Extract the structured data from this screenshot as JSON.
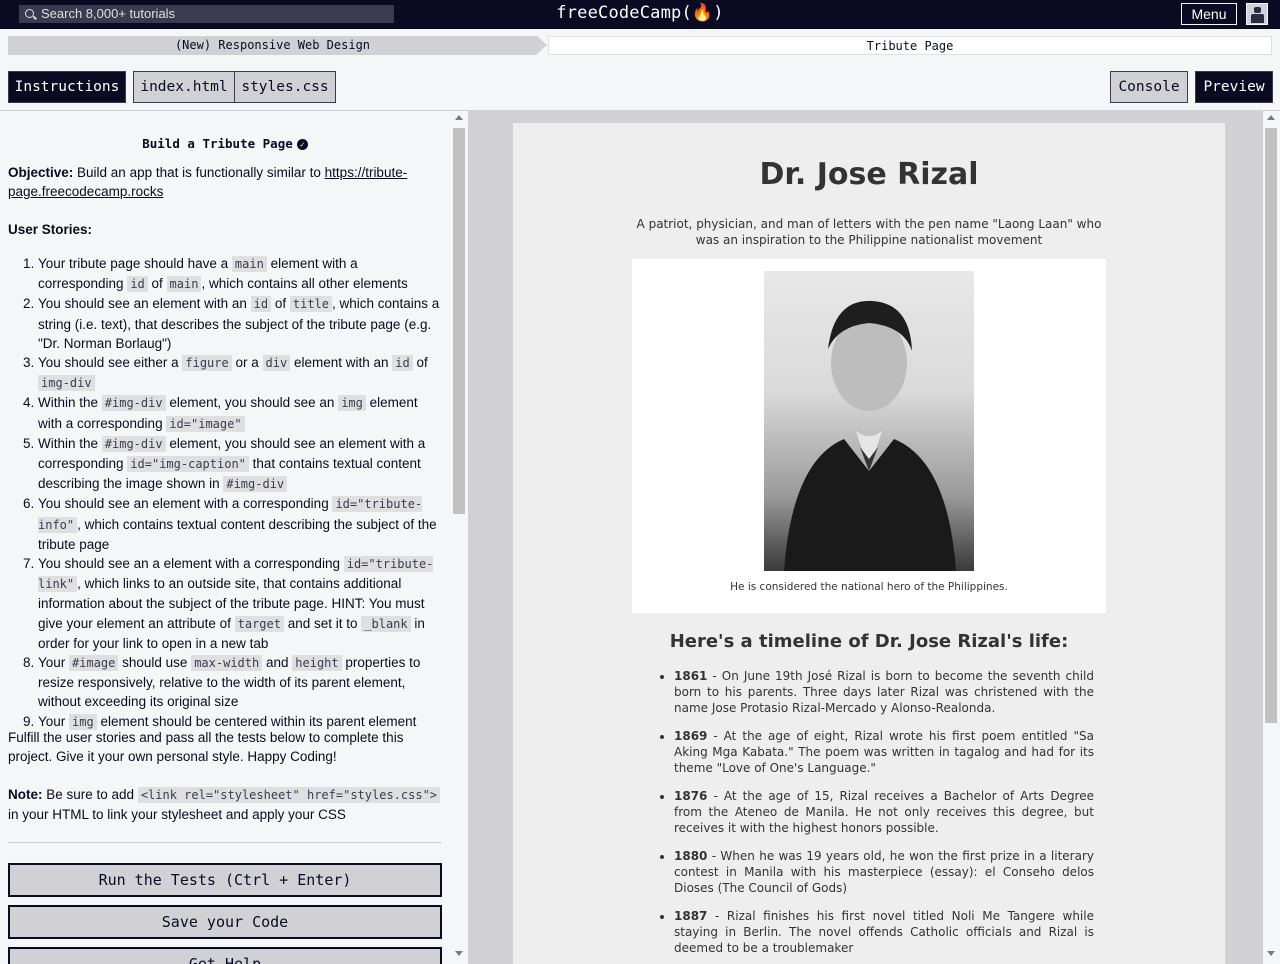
{
  "nav": {
    "search_placeholder": "Search 8,000+ tutorials",
    "brand": "freeCodeCamp(🔥)",
    "menu_label": "Menu"
  },
  "breadcrumb": {
    "course": "(New) Responsive Web Design",
    "project": "Tribute Page"
  },
  "tabs": {
    "instructions": "Instructions",
    "index_html": "index.html",
    "styles_css": "styles.css",
    "console": "Console",
    "preview": "Preview"
  },
  "instructions": {
    "title": "Build a Tribute Page",
    "objective_label": "Objective:",
    "objective_text": " Build an app that is functionally similar to ",
    "objective_link": "https://tribute-page.freecodecamp.rocks",
    "user_stories_label": "User Stories:",
    "stories": [
      [
        "Your tribute page should have a ",
        "main",
        " element with a corresponding ",
        "id",
        " of ",
        "main",
        ", which contains all other elements"
      ],
      [
        "You should see an element with an ",
        "id",
        " of ",
        "title",
        ", which contains a string (i.e. text), that describes the subject of the tribute page (e.g. \"Dr. Norman Borlaug\")"
      ],
      [
        "You should see either a ",
        "figure",
        " or a ",
        "div",
        " element with an ",
        "id",
        " of ",
        "img-div"
      ],
      [
        "Within the ",
        "#img-div",
        " element, you should see an ",
        "img",
        " element with a corresponding ",
        "id=\"image\""
      ],
      [
        "Within the ",
        "#img-div",
        " element, you should see an element with a corresponding ",
        "id=\"img-caption\"",
        " that contains textual content describing the image shown in ",
        "#img-div"
      ],
      [
        "You should see an element with a corresponding ",
        "id=\"tribute-info\"",
        ", which contains textual content describing the subject of the tribute page"
      ],
      [
        "You should see an a element with a corresponding ",
        "id=\"tribute-link\"",
        ", which links to an outside site, that contains additional information about the subject of the tribute page. HINT: You must give your element an attribute of ",
        "target",
        " and set it to ",
        "_blank",
        " in order for your link to open in a new tab"
      ],
      [
        "Your ",
        "#image",
        " should use ",
        "max-width",
        " and ",
        "height",
        " properties to resize responsively, relative to the width of its parent element, without exceeding its original size"
      ],
      [
        "Your ",
        "img",
        " element should be centered within its parent element"
      ]
    ],
    "fulfill": "Fulfill the user stories and pass all the tests below to complete this project. Give it your own personal style. Happy Coding!",
    "note_label": "Note:",
    "note_text_1": " Be sure to add ",
    "note_code": "<link rel=\"stylesheet\" href=\"styles.css\">",
    "note_text_2": " in your HTML to link your stylesheet and apply your CSS",
    "run_tests": "Run the Tests (Ctrl + Enter)",
    "save_code": "Save your Code",
    "get_help": "Get Help"
  },
  "preview": {
    "title": "Dr. Jose Rizal",
    "subtitle": "A patriot, physician, and man of letters with the pen name \"Laong Laan\" who was an inspiration to the Philippine nationalist movement",
    "caption": "He is considered the national hero of the Philippines.",
    "timeline_heading": "Here's a timeline of Dr. Jose Rizal's life:",
    "timeline": [
      {
        "year": "1861",
        "text": " - On June 19th José Rizal is born to become the seventh child born to his parents. Three days later Rizal was christened with the name Jose Protasio Rizal-Mercado y Alonso-Realonda."
      },
      {
        "year": "1869",
        "text": " - At the age of eight, Rizal wrote his first poem entitled \"Sa Aking Mga Kabata.\" The poem was written in tagalog and had for its theme \"Love of One's Language.\""
      },
      {
        "year": "1876",
        "text": " - At the age of 15, Rizal receives a Bachelor of Arts Degree from the Ateneo de Manila. He not only receives this degree, but receives it with the highest honors possible."
      },
      {
        "year": "1880",
        "text": " - When he was 19 years old, he won the first prize in a literary contest in Manila with his masterpiece (essay): el Conseho delos Dioses (The Council of Gods)"
      },
      {
        "year": "1887",
        "text": " - Rizal finishes his first novel titled Noli Me Tangere while staying in Berlin. The novel offends Catholic officials and Rizal is deemed to be a troublemaker"
      }
    ]
  }
}
